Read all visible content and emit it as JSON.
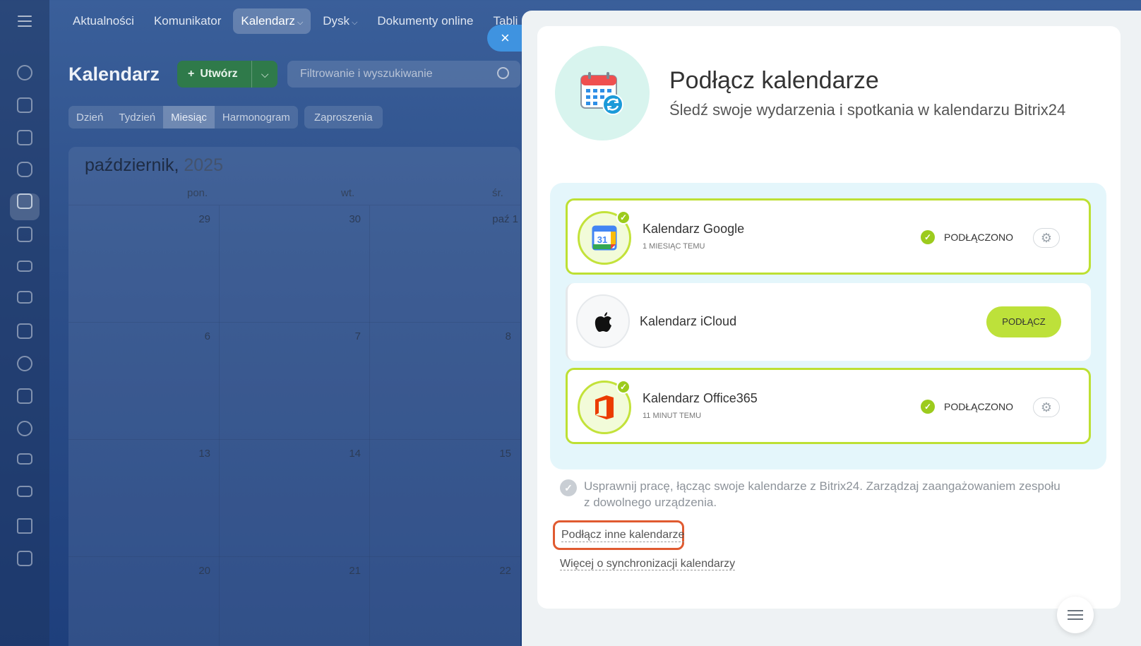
{
  "nav": {
    "items": [
      "Aktualności",
      "Komunikator",
      "Kalendarz",
      "Dysk",
      "Dokumenty online",
      "Tabli"
    ],
    "active": "Kalendarz"
  },
  "calendar": {
    "title": "Kalendarz",
    "create_label": "Utwórz",
    "filter_placeholder": "Filtrowanie i wyszukiwanie",
    "views": [
      "Dzień",
      "Tydzień",
      "Miesiąc",
      "Harmonogram"
    ],
    "active_view": "Miesiąc",
    "invites_label": "Zaproszenia",
    "month": "październik,",
    "year": "2025",
    "weekdays": [
      "pon.",
      "wt.",
      "śr."
    ],
    "weeks": [
      [
        "29",
        "30",
        "paź 1"
      ],
      [
        "6",
        "7",
        "8"
      ],
      [
        "13",
        "14",
        "15"
      ],
      [
        "20",
        "21",
        "22"
      ]
    ]
  },
  "panel": {
    "title": "Podłącz kalendarze",
    "subtitle": "Śledź swoje wydarzenia i spotkania w kalendarzu Bitrix24",
    "services": [
      {
        "name": "Kalendarz Google",
        "time": "1 MIESIĄC TEMU",
        "status": "PODŁĄCZONO",
        "icon": "google-calendar-icon"
      },
      {
        "name": "Kalendarz iCloud",
        "action": "PODŁĄCZ",
        "icon": "apple-icon"
      },
      {
        "name": "Kalendarz Office365",
        "time": "11 MINUT TEMU",
        "status": "PODŁĄCZONO",
        "icon": "office365-icon"
      }
    ],
    "info": "Usprawnij pracę, łącząc swoje kalendarze z Bitrix24. Zarządzaj zaangażowaniem zespołu z dowolnego urządzenia.",
    "link_other": "Podłącz inne kalendarze",
    "link_more": "Więcej o synchronizacji kalendarzy"
  },
  "colors": {
    "accent_green": "#bde13a",
    "check_green": "#9ccb1d",
    "highlight_red": "#e05a30",
    "close_blue": "#3f93e0"
  }
}
